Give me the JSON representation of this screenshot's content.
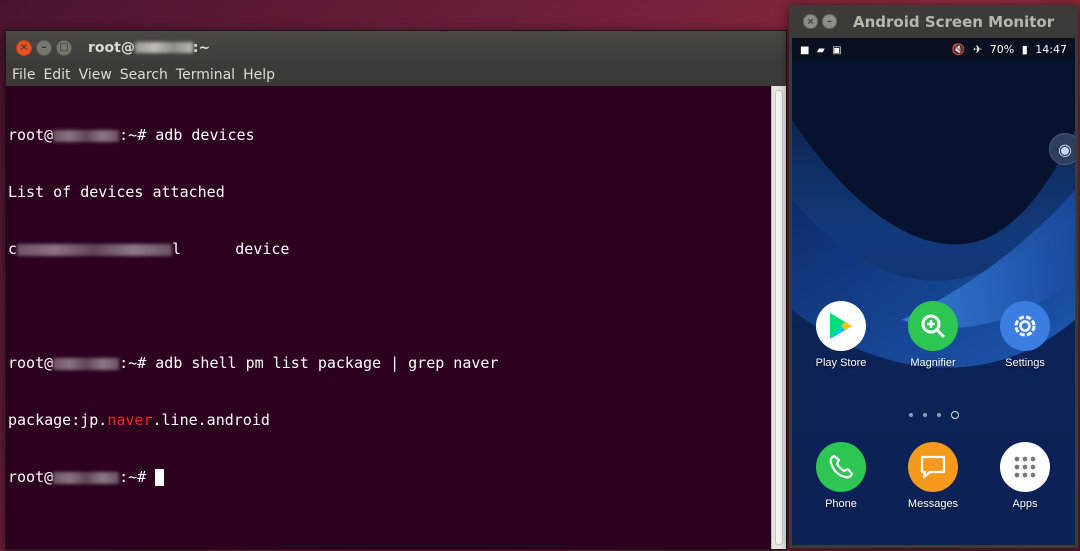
{
  "terminal": {
    "title_prefix": "root@",
    "title_suffix": ":~",
    "menu": [
      "File",
      "Edit",
      "View",
      "Search",
      "Terminal",
      "Help"
    ],
    "lines": {
      "l1_prompt_a": "root@",
      "l1_prompt_b": ":~# ",
      "l1_cmd": "adb devices",
      "l2": "List of devices attached",
      "l3_a": "c",
      "l3_b": "l      device",
      "l5_prompt_a": "root@",
      "l5_prompt_b": ":~# ",
      "l5_cmd": "adb shell pm list package | grep naver",
      "l6_a": "package:jp.",
      "l6_match": "naver",
      "l6_b": ".line.android",
      "l7_prompt_a": "root@",
      "l7_prompt_b": ":~# "
    }
  },
  "android_monitor": {
    "title": "Android Screen Monitor",
    "status": {
      "battery": "70%",
      "time": "14:47"
    },
    "apps": [
      {
        "label": "Play Store"
      },
      {
        "label": "Magnifier"
      },
      {
        "label": "Settings"
      },
      {
        "label": "Phone"
      },
      {
        "label": "Messages"
      },
      {
        "label": "Apps"
      }
    ]
  },
  "colors": {
    "terminal_bg": "#2c001e",
    "grep_match": "#ef2929",
    "close_button": "#e95420"
  }
}
